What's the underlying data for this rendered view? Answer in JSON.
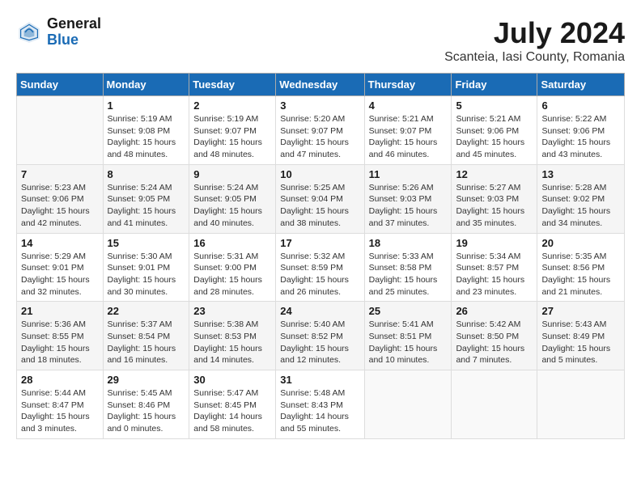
{
  "header": {
    "logo_general": "General",
    "logo_blue": "Blue",
    "month_title": "July 2024",
    "subtitle": "Scanteia, Iasi County, Romania"
  },
  "weekdays": [
    "Sunday",
    "Monday",
    "Tuesday",
    "Wednesday",
    "Thursday",
    "Friday",
    "Saturday"
  ],
  "weeks": [
    [
      {
        "day": "",
        "info": ""
      },
      {
        "day": "1",
        "info": "Sunrise: 5:19 AM\nSunset: 9:08 PM\nDaylight: 15 hours\nand 48 minutes."
      },
      {
        "day": "2",
        "info": "Sunrise: 5:19 AM\nSunset: 9:07 PM\nDaylight: 15 hours\nand 48 minutes."
      },
      {
        "day": "3",
        "info": "Sunrise: 5:20 AM\nSunset: 9:07 PM\nDaylight: 15 hours\nand 47 minutes."
      },
      {
        "day": "4",
        "info": "Sunrise: 5:21 AM\nSunset: 9:07 PM\nDaylight: 15 hours\nand 46 minutes."
      },
      {
        "day": "5",
        "info": "Sunrise: 5:21 AM\nSunset: 9:06 PM\nDaylight: 15 hours\nand 45 minutes."
      },
      {
        "day": "6",
        "info": "Sunrise: 5:22 AM\nSunset: 9:06 PM\nDaylight: 15 hours\nand 43 minutes."
      }
    ],
    [
      {
        "day": "7",
        "info": "Sunrise: 5:23 AM\nSunset: 9:06 PM\nDaylight: 15 hours\nand 42 minutes."
      },
      {
        "day": "8",
        "info": "Sunrise: 5:24 AM\nSunset: 9:05 PM\nDaylight: 15 hours\nand 41 minutes."
      },
      {
        "day": "9",
        "info": "Sunrise: 5:24 AM\nSunset: 9:05 PM\nDaylight: 15 hours\nand 40 minutes."
      },
      {
        "day": "10",
        "info": "Sunrise: 5:25 AM\nSunset: 9:04 PM\nDaylight: 15 hours\nand 38 minutes."
      },
      {
        "day": "11",
        "info": "Sunrise: 5:26 AM\nSunset: 9:03 PM\nDaylight: 15 hours\nand 37 minutes."
      },
      {
        "day": "12",
        "info": "Sunrise: 5:27 AM\nSunset: 9:03 PM\nDaylight: 15 hours\nand 35 minutes."
      },
      {
        "day": "13",
        "info": "Sunrise: 5:28 AM\nSunset: 9:02 PM\nDaylight: 15 hours\nand 34 minutes."
      }
    ],
    [
      {
        "day": "14",
        "info": "Sunrise: 5:29 AM\nSunset: 9:01 PM\nDaylight: 15 hours\nand 32 minutes."
      },
      {
        "day": "15",
        "info": "Sunrise: 5:30 AM\nSunset: 9:01 PM\nDaylight: 15 hours\nand 30 minutes."
      },
      {
        "day": "16",
        "info": "Sunrise: 5:31 AM\nSunset: 9:00 PM\nDaylight: 15 hours\nand 28 minutes."
      },
      {
        "day": "17",
        "info": "Sunrise: 5:32 AM\nSunset: 8:59 PM\nDaylight: 15 hours\nand 26 minutes."
      },
      {
        "day": "18",
        "info": "Sunrise: 5:33 AM\nSunset: 8:58 PM\nDaylight: 15 hours\nand 25 minutes."
      },
      {
        "day": "19",
        "info": "Sunrise: 5:34 AM\nSunset: 8:57 PM\nDaylight: 15 hours\nand 23 minutes."
      },
      {
        "day": "20",
        "info": "Sunrise: 5:35 AM\nSunset: 8:56 PM\nDaylight: 15 hours\nand 21 minutes."
      }
    ],
    [
      {
        "day": "21",
        "info": "Sunrise: 5:36 AM\nSunset: 8:55 PM\nDaylight: 15 hours\nand 18 minutes."
      },
      {
        "day": "22",
        "info": "Sunrise: 5:37 AM\nSunset: 8:54 PM\nDaylight: 15 hours\nand 16 minutes."
      },
      {
        "day": "23",
        "info": "Sunrise: 5:38 AM\nSunset: 8:53 PM\nDaylight: 15 hours\nand 14 minutes."
      },
      {
        "day": "24",
        "info": "Sunrise: 5:40 AM\nSunset: 8:52 PM\nDaylight: 15 hours\nand 12 minutes."
      },
      {
        "day": "25",
        "info": "Sunrise: 5:41 AM\nSunset: 8:51 PM\nDaylight: 15 hours\nand 10 minutes."
      },
      {
        "day": "26",
        "info": "Sunrise: 5:42 AM\nSunset: 8:50 PM\nDaylight: 15 hours\nand 7 minutes."
      },
      {
        "day": "27",
        "info": "Sunrise: 5:43 AM\nSunset: 8:49 PM\nDaylight: 15 hours\nand 5 minutes."
      }
    ],
    [
      {
        "day": "28",
        "info": "Sunrise: 5:44 AM\nSunset: 8:47 PM\nDaylight: 15 hours\nand 3 minutes."
      },
      {
        "day": "29",
        "info": "Sunrise: 5:45 AM\nSunset: 8:46 PM\nDaylight: 15 hours\nand 0 minutes."
      },
      {
        "day": "30",
        "info": "Sunrise: 5:47 AM\nSunset: 8:45 PM\nDaylight: 14 hours\nand 58 minutes."
      },
      {
        "day": "31",
        "info": "Sunrise: 5:48 AM\nSunset: 8:43 PM\nDaylight: 14 hours\nand 55 minutes."
      },
      {
        "day": "",
        "info": ""
      },
      {
        "day": "",
        "info": ""
      },
      {
        "day": "",
        "info": ""
      }
    ]
  ]
}
